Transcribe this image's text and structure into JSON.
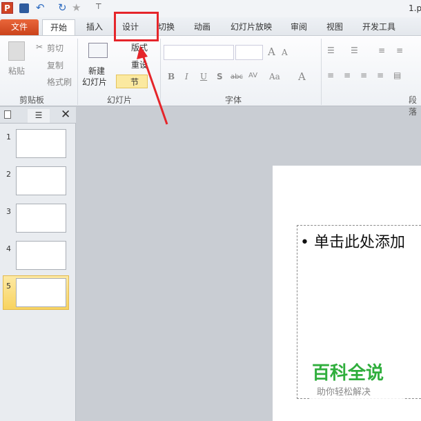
{
  "title": "1.p",
  "tabs": [
    "文件",
    "开始",
    "插入",
    "设计",
    "切换",
    "动画",
    "幻灯片放映",
    "审阅",
    "视图",
    "开发工具"
  ],
  "clipboard": {
    "paste": "粘贴",
    "cut": "剪切",
    "copy": "复制",
    "format_painter": "格式刷",
    "group": "剪贴板"
  },
  "slides": {
    "new_slide_1": "新建",
    "new_slide_2": "幻灯片",
    "layout": "版式",
    "reset": "重设",
    "section": "节",
    "group": "幻灯片"
  },
  "font": {
    "group": "字体",
    "bold": "B",
    "italic": "I",
    "underline": "U",
    "shadow": "S",
    "strike": "abc",
    "spacing": "AV",
    "case": "Aa",
    "color": "A",
    "grow": "A",
    "shrink": "A"
  },
  "paragraph": {
    "group": "段落"
  },
  "slide_numbers": [
    "1",
    "2",
    "3",
    "4",
    "5"
  ],
  "placeholder_text": "单击此处添加",
  "watermark": {
    "title": "百科全说",
    "subtitle": "助你轻松解决"
  }
}
